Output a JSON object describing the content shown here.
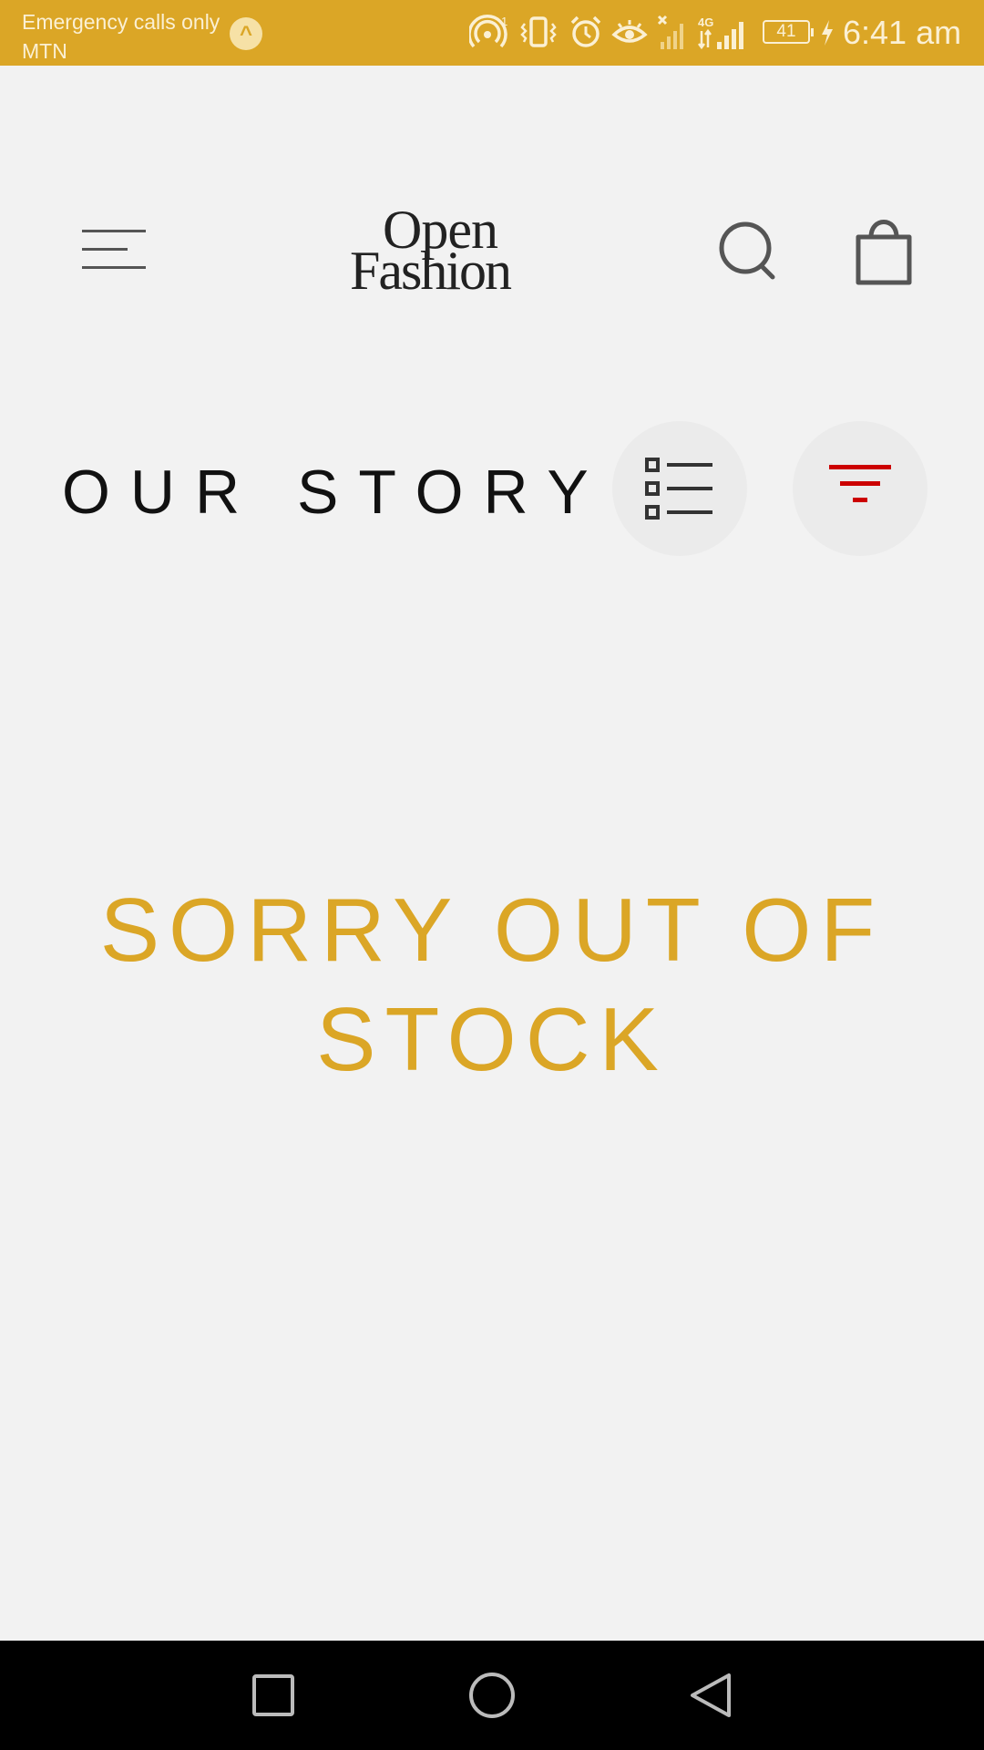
{
  "status_bar": {
    "carrier_line1": "Emergency calls only",
    "carrier_line2": "MTN",
    "notification_icon": "caret-up-icon",
    "battery_level": "41",
    "time": "6:41 am",
    "background_color": "#dba626",
    "icons": [
      "hotspot-icon",
      "vibrate-icon",
      "alarm-icon",
      "eye-comfort-icon",
      "no-signal-icon",
      "4g-signal-icon",
      "battery-icon",
      "charging-icon"
    ]
  },
  "header": {
    "logo_line1": "Open",
    "logo_line2": "Fashion",
    "menu_icon": "hamburger-menu-icon",
    "search_icon": "search-icon",
    "bag_icon": "shopping-bag-icon"
  },
  "title_row": {
    "title": "OUR STORY",
    "list_view_icon": "list-view-icon",
    "filter_icon": "filter-icon",
    "filter_color": "#cc0000"
  },
  "message": {
    "text": "SORRY OUT OF STOCK",
    "color": "#dba626"
  },
  "nav_bar": {
    "icons": [
      "recents-square-icon",
      "home-circle-icon",
      "back-triangle-icon"
    ]
  }
}
